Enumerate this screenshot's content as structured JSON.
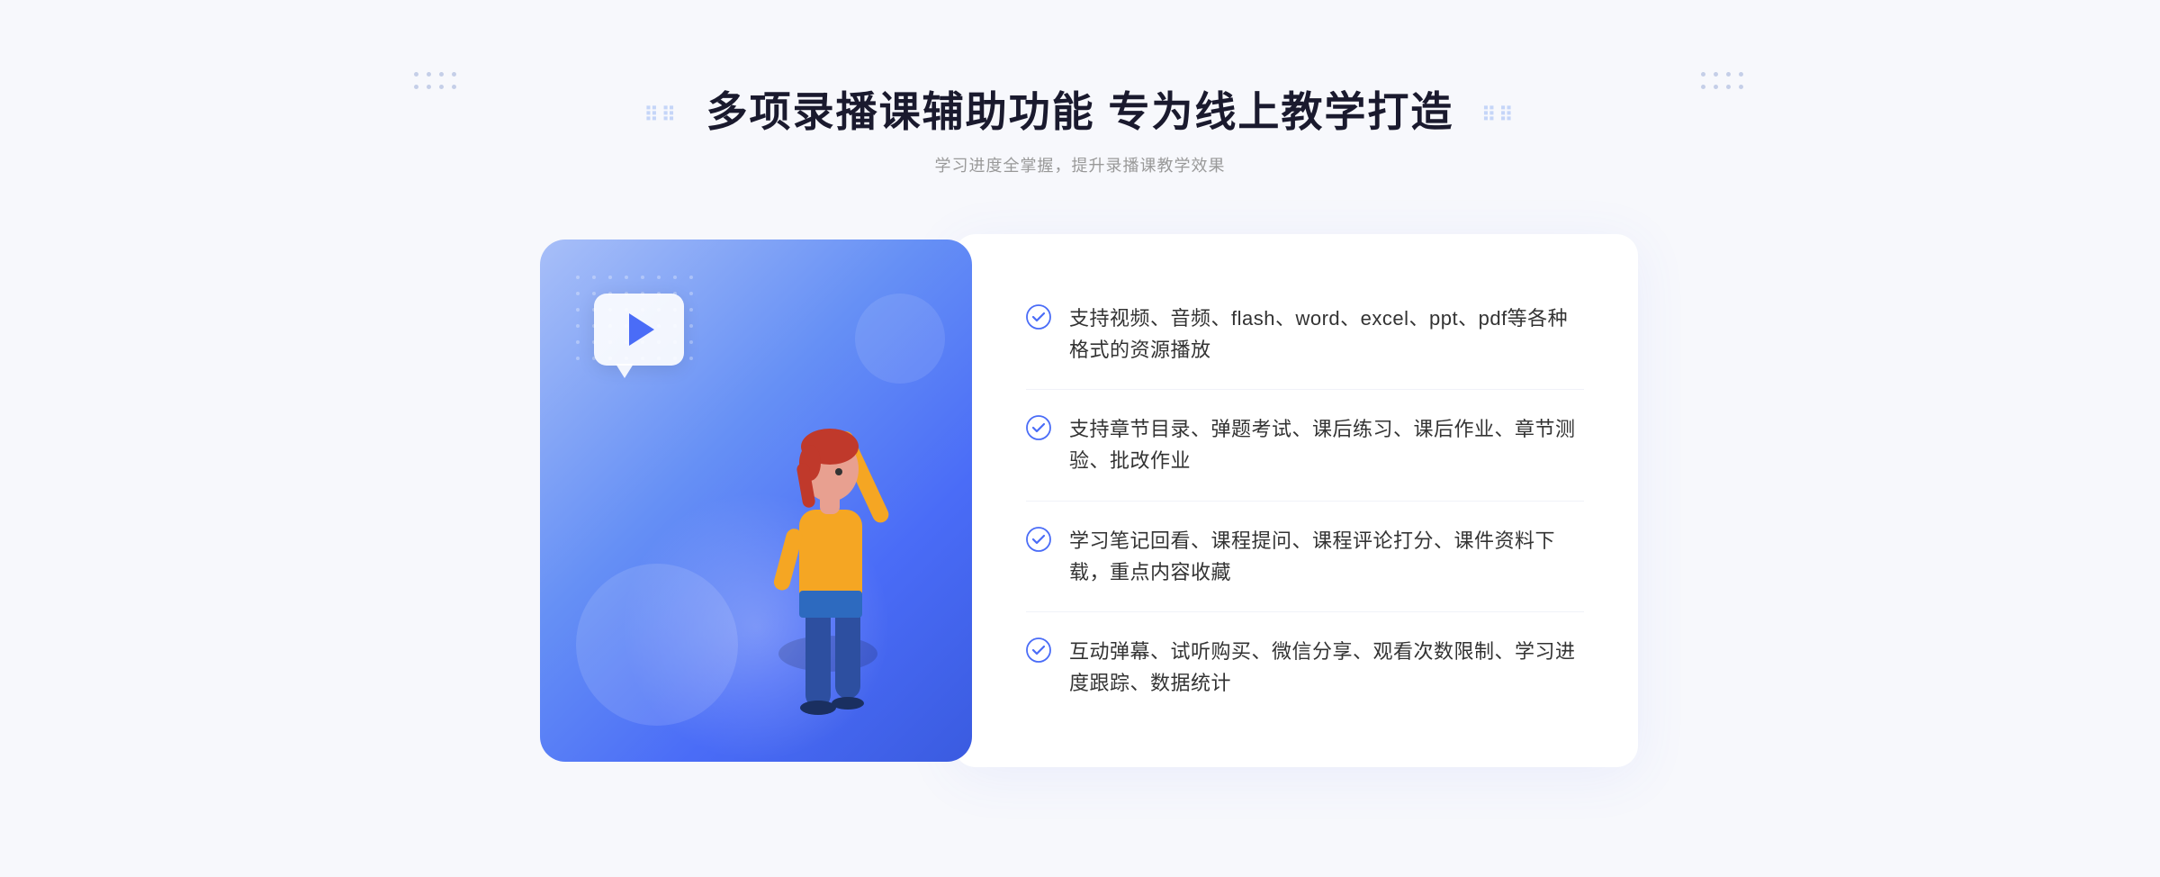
{
  "page": {
    "background_color": "#f7f8fc"
  },
  "header": {
    "title": "多项录播课辅助功能 专为线上教学打造",
    "subtitle": "学习进度全掌握，提升录播课教学效果"
  },
  "features": [
    {
      "id": 1,
      "text": "支持视频、音频、flash、word、excel、ppt、pdf等各种格式的资源播放"
    },
    {
      "id": 2,
      "text": "支持章节目录、弹题考试、课后练习、课后作业、章节测验、批改作业"
    },
    {
      "id": 3,
      "text": "学习笔记回看、课程提问、课程评论打分、课件资料下载，重点内容收藏"
    },
    {
      "id": 4,
      "text": "互动弹幕、试听购买、微信分享、观看次数限制、学习进度跟踪、数据统计"
    }
  ],
  "decoration": {
    "dots_label": "····",
    "arrow_chars": "«"
  }
}
